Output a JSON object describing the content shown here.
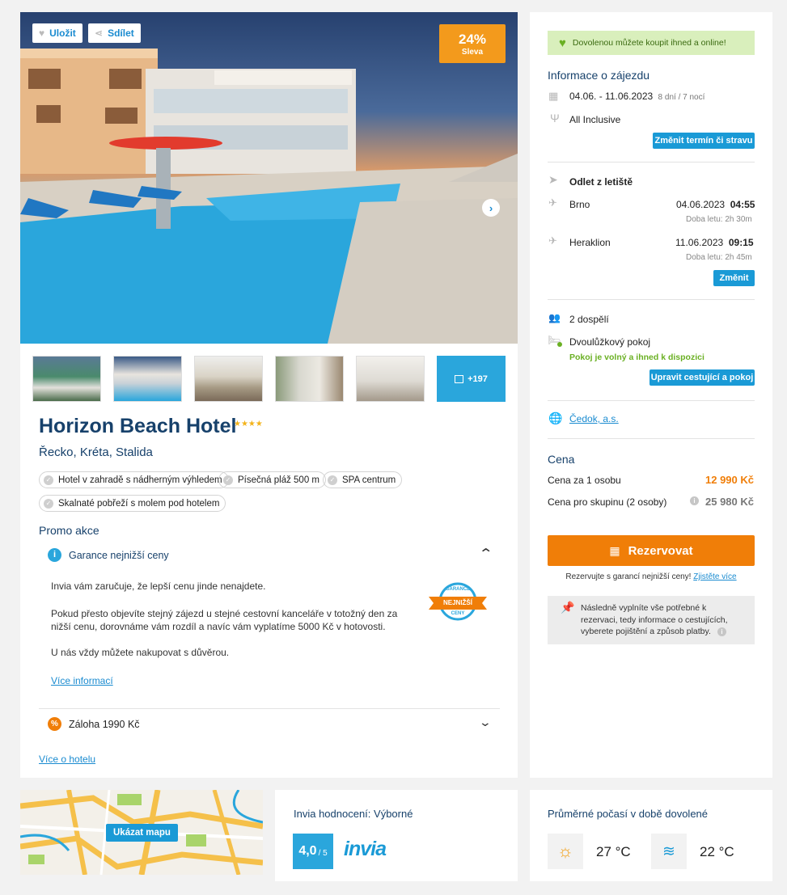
{
  "hero": {
    "save_label": "Uložit",
    "share_label": "Sdílet",
    "discount_percent": "24%",
    "discount_label": "Sleva",
    "more_photos": "+197"
  },
  "hotel": {
    "name": "Horizon Beach Hotel",
    "stars": 4,
    "location": "Řecko, Kréta, Stalida",
    "tags": [
      "Hotel v zahradě s nádherným výhledem",
      "Písečná pláž 500 m",
      "SPA centrum",
      "Skalnaté pobřeží s molem pod hotelem"
    ]
  },
  "promo": {
    "heading": "Promo akce",
    "guarantee_title": "Garance nejnižší ceny",
    "text1": "Invia vám zaručuje, že lepší cenu jinde nenajdete.",
    "text2": "Pokud přesto objevíte stejný zájezd u stejné cestovní kanceláře v totožný den za nižší cenu, dorovnáme vám rozdíl a navíc vám vyplatíme 5000 Kč v hotovosti.",
    "text3": "U nás vždy můžete nakupovat s důvěrou.",
    "more_info": "Více informací",
    "badge_top": "GARANCE",
    "badge_mid": "NEJNIŽŠÍ",
    "badge_bot": "CENY",
    "deposit_title": "Záloha 1990 Kč",
    "hotel_link": "Více o hotelu"
  },
  "sidebar": {
    "online_notice": "Dovolenou můžete koupit ihned a online!",
    "info_heading": "Informace o zájezdu",
    "dates": "04.06. - 11.06.2023",
    "duration": "8 dní / 7 nocí",
    "board": "All Inclusive",
    "change_term_btn": "Změnit termín či stravu",
    "departure_heading": "Odlet z letiště",
    "out_city": "Brno",
    "out_date": "04.06.2023",
    "out_time": "04:55",
    "out_duration": "Doba letu: 2h 30m",
    "back_city": "Heraklion",
    "back_date": "11.06.2023",
    "back_time": "09:15",
    "back_duration": "Doba letu: 2h 45m",
    "change_btn": "Změnit",
    "travellers": "2 dospělí",
    "room": "Dvoulůžkový pokoj",
    "room_status": "Pokoj je volný a ihned k dispozici",
    "edit_btn": "Upravit cestující a pokoj",
    "agency": "Čedok, a.s.",
    "price_heading": "Cena",
    "price_person_label": "Cena za 1 osobu",
    "price_person": "12 990 Kč",
    "price_group_label": "Cena pro skupinu (2 osoby)",
    "price_group": "25 980 Kč",
    "book_btn": "Rezervovat",
    "guarantee_note": "Rezervujte s garancí nejnižší ceny!",
    "guarantee_link": "Zjistěte více",
    "next_steps": "Následně vyplníte vše potřebné k rezervaci, tedy informace o cestujících, vyberete pojištění a způsob platby."
  },
  "bottom": {
    "map_btn": "Ukázat mapu",
    "rating_title": "Invia hodnocení: Výborné",
    "rating_value": "4,0",
    "rating_scale": "/ 5",
    "invia_logo": "invia",
    "weather_title": "Průměrné počasí v době dovolené",
    "air_temp": "27 °C",
    "water_temp": "22 °C"
  },
  "colors": {
    "accent_blue": "#1a9ad6",
    "brand_orange": "#f07e08",
    "title_blue": "#17416b",
    "green": "#6ab023"
  }
}
